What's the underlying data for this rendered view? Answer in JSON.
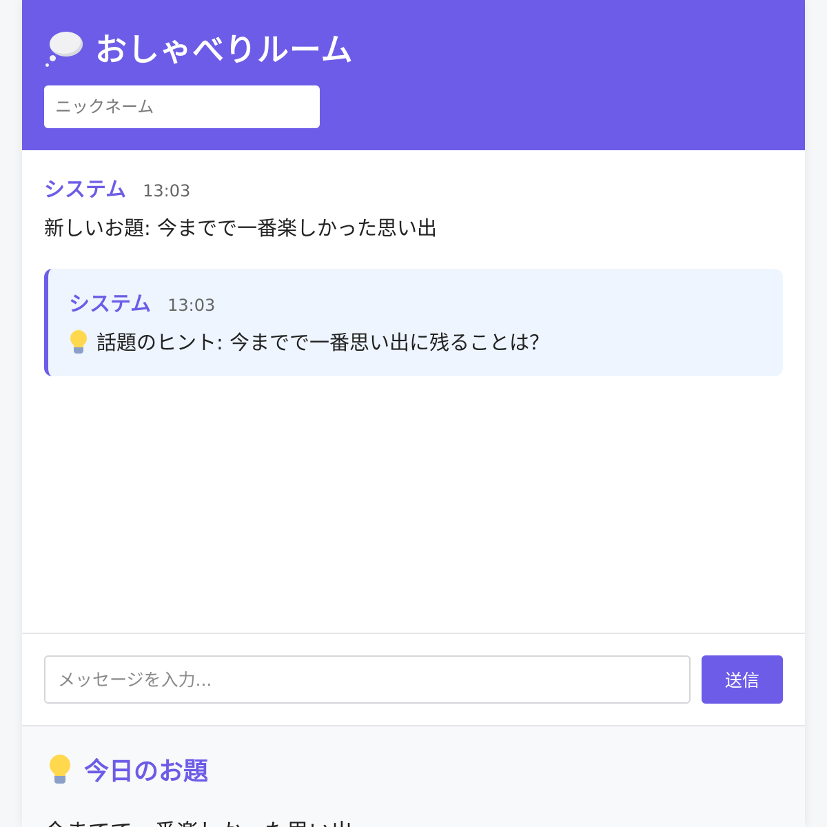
{
  "header": {
    "title": "おしゃべりルーム",
    "icon": "thought-bubble-icon",
    "nickname_placeholder": "ニックネーム",
    "background_color": "#6c5ce7"
  },
  "messages": [
    {
      "author": "システム",
      "time": "13:03",
      "text": "新しいお題: 今までで一番楽しかった思い出",
      "type": "normal"
    },
    {
      "author": "システム",
      "time": "13:03",
      "icon": "lightbulb-icon",
      "text": "話題のヒント: 今までで一番思い出に残ることは？",
      "type": "hint"
    }
  ],
  "composer": {
    "placeholder": "メッセージを入力...",
    "send_label": "送信"
  },
  "topic": {
    "icon": "lightbulb-icon",
    "heading": "今日のお題",
    "text": "今までで一番楽しかった思い出"
  },
  "colors": {
    "accent": "#6c5ce7",
    "hint_background": "#eef5ff"
  }
}
